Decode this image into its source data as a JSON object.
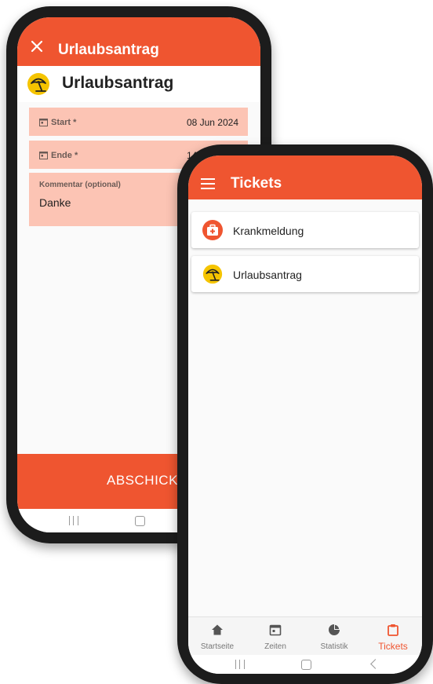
{
  "leave_screen": {
    "title": "Urlaubsantrag",
    "section_title": "Urlaubsantrag",
    "fields": [
      {
        "label": "Start *",
        "value": "08 Jun 2024"
      },
      {
        "label": "Ende *",
        "value": "14 Jun 2024"
      },
      {
        "label": "Kommentar (optional)",
        "value": "Danke"
      }
    ],
    "submit_label": "ABSCHICKEN"
  },
  "tickets_screen": {
    "title": "Tickets",
    "items": [
      {
        "label": "Krankmeldung",
        "icon": "first-aid-kit-icon"
      },
      {
        "label": "Urlaubsantrag",
        "icon": "beach-umbrella-icon"
      }
    ],
    "bottom_nav": [
      {
        "label": "Startseite",
        "icon": "home-icon",
        "active": false
      },
      {
        "label": "Zeiten",
        "icon": "calendar-icon",
        "active": false
      },
      {
        "label": "Statistik",
        "icon": "pie-chart-icon",
        "active": false
      },
      {
        "label": "Tickets",
        "icon": "clipboard-icon",
        "active": true
      }
    ]
  },
  "colors": {
    "accent": "#ef5530",
    "field_bg": "#fcc4b4",
    "umbrella_bg": "#f5c400",
    "text": "#222222"
  }
}
